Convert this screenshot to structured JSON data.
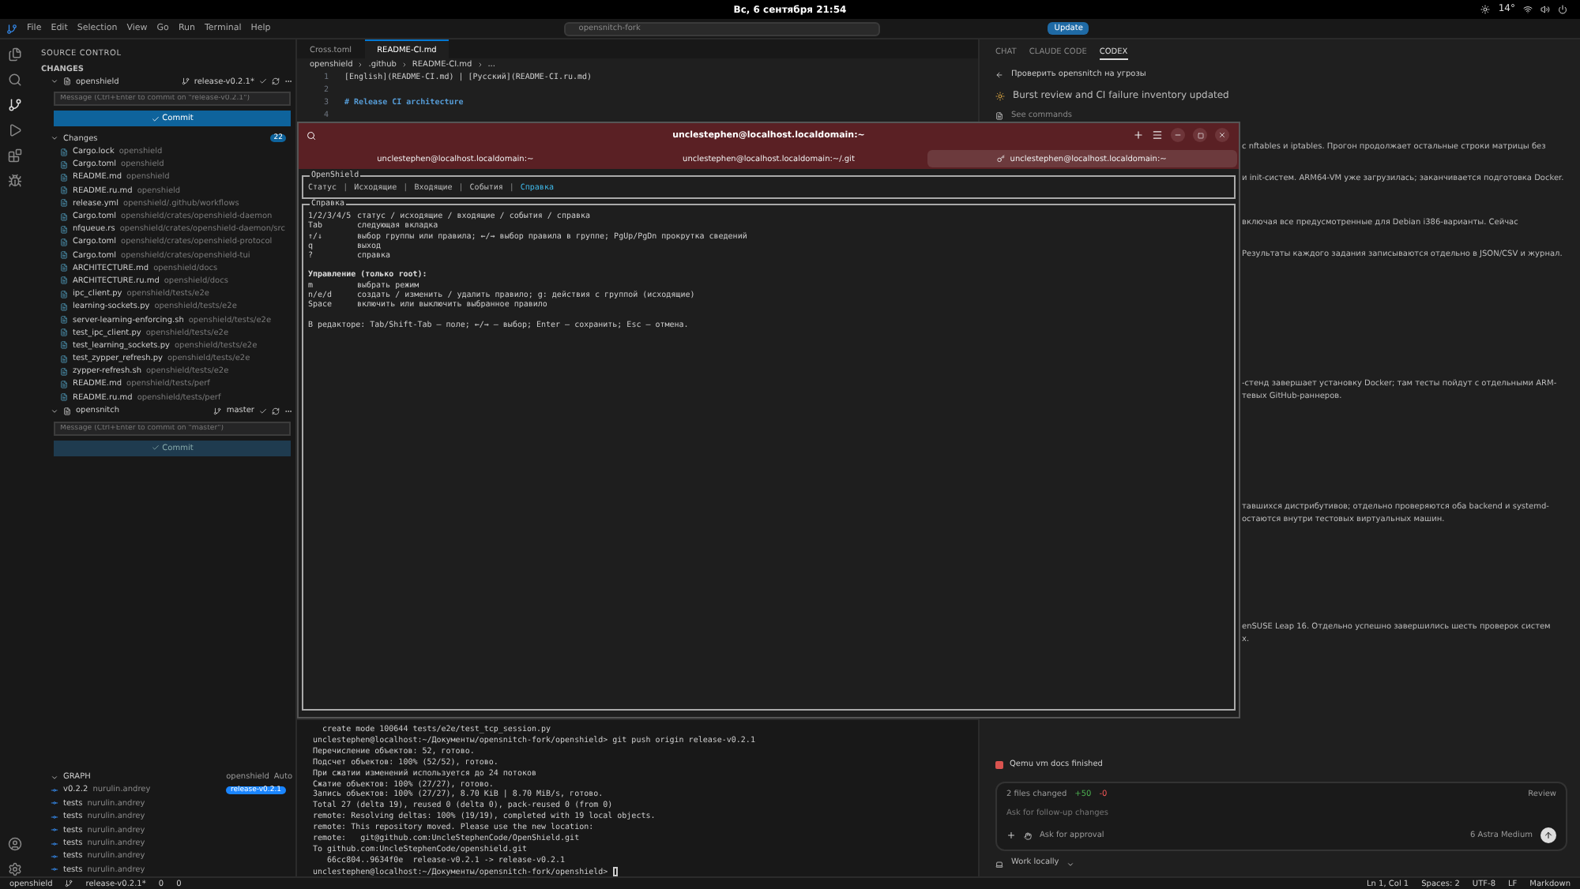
{
  "system_bar": {
    "datetime": "Вс, 6 сентября 21:54",
    "temperature": "14°"
  },
  "menu": [
    "File",
    "Edit",
    "Selection",
    "View",
    "Go",
    "Run",
    "Terminal",
    "Help"
  ],
  "command_center": {
    "text": "opensnitch-fork"
  },
  "update_button": "Update",
  "source_control": {
    "title": "SOURCE CONTROL",
    "section": "CHANGES",
    "repos": [
      {
        "name": "openshield",
        "branch": "release-v0.2.1*",
        "placeholder": "Message (Ctrl+Enter to commit on \"release-v0.2.1\")",
        "commit": "Commit",
        "disabled": false,
        "changes_label": "Changes",
        "changes_count": "22",
        "files": [
          {
            "name": "Cargo.lock",
            "path": "openshield"
          },
          {
            "name": "Cargo.toml",
            "path": "openshield"
          },
          {
            "name": "README.md",
            "path": "openshield"
          },
          {
            "name": "README.ru.md",
            "path": "openshield"
          },
          {
            "name": "release.yml",
            "path": "openshield/.github/workflows"
          },
          {
            "name": "Cargo.toml",
            "path": "openshield/crates/openshield-daemon"
          },
          {
            "name": "nfqueue.rs",
            "path": "openshield/crates/openshield-daemon/src"
          },
          {
            "name": "Cargo.toml",
            "path": "openshield/crates/openshield-protocol"
          },
          {
            "name": "Cargo.toml",
            "path": "openshield/crates/openshield-tui"
          },
          {
            "name": "ARCHITECTURE.md",
            "path": "openshield/docs"
          },
          {
            "name": "ARCHITECTURE.ru.md",
            "path": "openshield/docs"
          },
          {
            "name": "ipc_client.py",
            "path": "openshield/tests/e2e"
          },
          {
            "name": "learning-sockets.py",
            "path": "openshield/tests/e2e"
          },
          {
            "name": "server-learning-enforcing.sh",
            "path": "openshield/tests/e2e"
          },
          {
            "name": "test_ipc_client.py",
            "path": "openshield/tests/e2e"
          },
          {
            "name": "test_learning_sockets.py",
            "path": "openshield/tests/e2e"
          },
          {
            "name": "test_zypper_refresh.py",
            "path": "openshield/tests/e2e"
          },
          {
            "name": "zypper-refresh.sh",
            "path": "openshield/tests/e2e"
          },
          {
            "name": "README.md",
            "path": "openshield/tests/perf"
          },
          {
            "name": "README.ru.md",
            "path": "openshield/tests/perf"
          }
        ]
      },
      {
        "name": "opensnitch",
        "branch": "master",
        "placeholder": "Message (Ctrl+Enter to commit on \"master\")",
        "commit": "Commit",
        "disabled": true
      }
    ],
    "graph": {
      "title": "GRAPH",
      "repo": "openshield",
      "mode": "Auto",
      "commits": [
        {
          "message": "v0.2.2",
          "author": "nurulin.andrey",
          "ref": "release-v0.2.1"
        },
        {
          "message": "tests",
          "author": "nurulin.andrey"
        },
        {
          "message": "tests",
          "author": "nurulin.andrey"
        },
        {
          "message": "tests",
          "author": "nurulin.andrey"
        },
        {
          "message": "tests",
          "author": "nurulin.andrey"
        },
        {
          "message": "tests",
          "author": "nurulin.andrey"
        },
        {
          "message": "tests",
          "author": "nurulin.andrey"
        }
      ]
    }
  },
  "editor": {
    "tabs": [
      {
        "label": "Cross.toml",
        "selected": false
      },
      {
        "label": "README-CI.md",
        "selected": true
      }
    ],
    "breadcrumb": [
      "openshield",
      ".github",
      "README-CI.md",
      "..."
    ],
    "lines": [
      {
        "number": "1",
        "text": "[English](README-CI.md) | [Русский](README-CI.ru.md)",
        "kind": "text"
      },
      {
        "number": "2"
      },
      {
        "number": "3",
        "text": "# Release CI architecture",
        "kind": "heading"
      },
      {
        "number": "4"
      }
    ]
  },
  "terminal_panel": {
    "lines": [
      "  create mode 100644 tests/e2e/test_tcp_session.py",
      "unclestephen@localhost:~/Документы/opensnitch-fork/openshield> git push origin release-v0.2.1",
      "Перечисление объектов: 52, готово.",
      "Подсчет объектов: 100% (52/52), готово.",
      "При сжатии изменений используется до 24 потоков",
      "Сжатие объектов: 100% (27/27), готово.",
      "Запись объектов: 100% (27/27), 8.70 KiB | 8.70 MiB/s, готово.",
      "Total 27 (delta 19), reused 0 (delta 0), pack-reused 0 (from 0)",
      "remote: Resolving deltas: 100% (19/19), completed with 19 local objects.",
      "remote: This repository moved. Please use the new location:",
      "remote:   git@github.com:UncleStephenCode/OpenShield.git",
      "To github.com:UncleStephenCode/openshield.git",
      "   66cc804..9634f0e  release-v0.2.1 -> release-v0.2.1",
      "unclestephen@localhost:~/Документы/opensnitch-fork/openshield> "
    ]
  },
  "chat_panel": {
    "tabs": [
      {
        "label": "CHAT",
        "selected": false
      },
      {
        "label": "CLAUDE CODE",
        "selected": false
      },
      {
        "label": "CODEX",
        "selected": true
      }
    ],
    "back_title": "Проверить opensnitch на угрозы",
    "task": "Burst review and CI failure inventory updated",
    "see_commands": "See commands",
    "fragments": [
      [
        "с nftables и iptables. Прогон продолжает остальные строки матрицы без"
      ],
      [
        "и init-систем. ARM64-VM уже загрузилась; заканчивается подготовка Docker."
      ],
      [
        "включая все предусмотренные для Debian i386-варианты. Сейчас"
      ],
      [
        "Результаты каждого задания записываются отдельно в JSON/CSV и журнал."
      ],
      [
        "-стенд завершает установку Docker; там тесты пойдут с отдельными ARM-",
        "тевых GitHub-раннеров."
      ],
      [
        "тавшихся дистрибутивов; отдельно проверяются оба backend и systemd-",
        "остаются внутри тестовых виртуальных машин."
      ],
      [
        "enSUSE Leap 16. Отдельно успешно завершились шесть проверок систем",
        "х."
      ]
    ],
    "finished": "Qemu vm docs finished",
    "composer": {
      "files_changed": "2 files changed",
      "added": "+50",
      "removed": "-0",
      "review": "Review",
      "placeholder": "Ask for follow-up changes",
      "approval": "Ask for approval",
      "model": "6 Astra Medium",
      "mode": "Work locally"
    }
  },
  "status_bar": {
    "repo": "openshield",
    "branch": "release-v0.2.1*",
    "errors": "0",
    "warnings": "0",
    "position": "Ln 1, Col 1",
    "spaces": "Spaces: 2",
    "encoding": "UTF-8",
    "eol": "LF",
    "language": "Markdown"
  },
  "terminal_window": {
    "title": "unclestephen@localhost.localdomain:~",
    "tabs": [
      {
        "label": "unclestephen@localhost.localdomain:~",
        "selected": false
      },
      {
        "label": "unclestephen@localhost.localdomain:~/.git",
        "selected": false
      },
      {
        "label": "unclestephen@localhost.localdomain:~",
        "selected": true
      }
    ],
    "app_title": "OpenShield",
    "separator": "|",
    "app_tabs": [
      {
        "label": "Статус",
        "selected": false
      },
      {
        "label": "Исходящие",
        "selected": false
      },
      {
        "label": "Входящие",
        "selected": false
      },
      {
        "label": "События",
        "selected": false
      },
      {
        "label": "Справка",
        "selected": true
      }
    ],
    "help_title": "Справка",
    "keys": [
      {
        "key": "1/2/3/4/5",
        "desc": "статус / исходящие / входящие / события / справка"
      },
      {
        "key": "Tab",
        "desc": "следующая вкладка"
      },
      {
        "key": "↑/↓",
        "desc": "выбор группы или правила; ←/→ выбор правила в группе; PgUp/PgDn прокрутка сведений"
      },
      {
        "key": "q",
        "desc": "выход"
      },
      {
        "key": "?",
        "desc": "справка"
      }
    ],
    "admin_heading": "Управление (только root):",
    "admin_keys": [
      {
        "key": "m",
        "desc": "выбрать режим"
      },
      {
        "key": "n/e/d",
        "desc": "создать / изменить / удалить правило; g: действия с группой (исходящие)"
      },
      {
        "key": "Space",
        "desc": "включить или выключить выбранное правило"
      }
    ],
    "footer": "В редакторе: Tab/Shift-Tab – поле; ←/→ – выбор; Enter – сохранить; Esc – отмена."
  }
}
